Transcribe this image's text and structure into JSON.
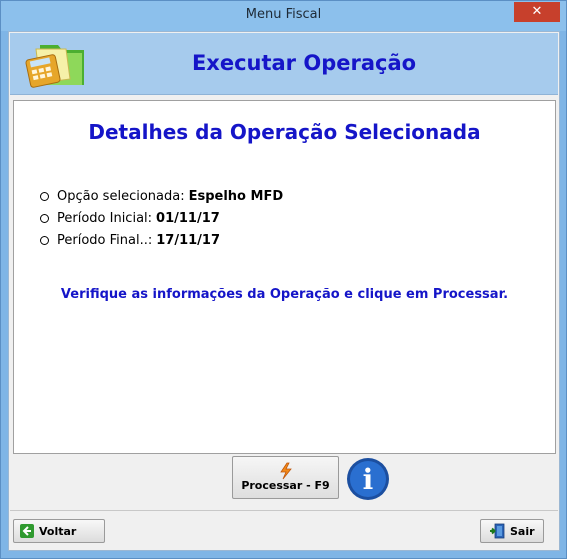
{
  "window": {
    "title": "Menu Fiscal",
    "close_glyph": "✕"
  },
  "header": {
    "title": "Executar Operação",
    "icon": "calculator-folder-icon"
  },
  "details": {
    "title": "Detalhes da Operação Selecionada",
    "items": [
      {
        "label": "Opção selecionada:",
        "value": "Espelho MFD"
      },
      {
        "label": "Período Inicial:",
        "value": "01/11/17"
      },
      {
        "label": "Período Final..:",
        "value": "17/11/17"
      }
    ],
    "notice": "Verifique as informações da Operação e clique em Processar."
  },
  "actions": {
    "processar_label": "Processar - F9",
    "processar_icon": "lightning-icon",
    "info_icon": "info-icon",
    "info_glyph": "i"
  },
  "footer": {
    "voltar_label": "Voltar",
    "voltar_icon": "back-arrow-icon",
    "sair_label": "Sair",
    "sair_icon": "exit-door-icon"
  },
  "colors": {
    "accent_title": "#1515c8",
    "titlebar": "#8cc0ec",
    "header_panel": "#a6cbed",
    "close_button": "#c7402c"
  }
}
